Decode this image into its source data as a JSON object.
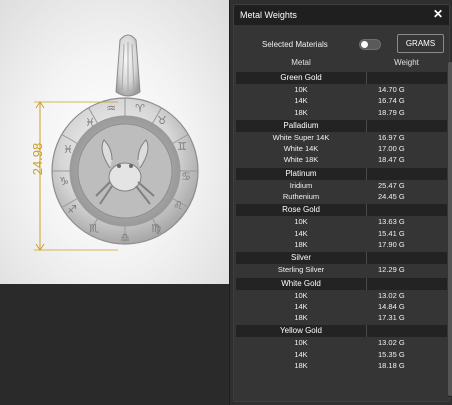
{
  "viewport": {
    "dimension_label": "24.98",
    "accent_color": "#c9a227"
  },
  "panel": {
    "title": "Metal Weights",
    "close_icon": "close-icon",
    "selected_materials_label": "Selected Materials",
    "selected_materials_toggle_on": false,
    "unit_button_label": "GRAMS",
    "columns": [
      "Metal",
      "Weight"
    ],
    "groups": [
      {
        "name": "Green Gold",
        "rows": [
          {
            "metal": "10K",
            "weight": "14.70 G"
          },
          {
            "metal": "14K",
            "weight": "16.74 G"
          },
          {
            "metal": "18K",
            "weight": "18.79 G"
          }
        ]
      },
      {
        "name": "Palladium",
        "rows": [
          {
            "metal": "White Super 14K",
            "weight": "16.97 G"
          },
          {
            "metal": "White 14K",
            "weight": "17.00 G"
          },
          {
            "metal": "White 18K",
            "weight": "18.47 G"
          }
        ]
      },
      {
        "name": "Platinum",
        "rows": [
          {
            "metal": "Iridium",
            "weight": "25.47 G"
          },
          {
            "metal": "Ruthenium",
            "weight": "24.45 G"
          }
        ]
      },
      {
        "name": "Rose Gold",
        "rows": [
          {
            "metal": "10K",
            "weight": "13.63 G"
          },
          {
            "metal": "14K",
            "weight": "15.41 G"
          },
          {
            "metal": "18K",
            "weight": "17.90 G"
          }
        ]
      },
      {
        "name": "Silver",
        "rows": [
          {
            "metal": "Sterling Silver",
            "weight": "12.29 G"
          }
        ]
      },
      {
        "name": "White Gold",
        "rows": [
          {
            "metal": "10K",
            "weight": "13.02 G"
          },
          {
            "metal": "14K",
            "weight": "14.84 G"
          },
          {
            "metal": "18K",
            "weight": "17.31 G"
          }
        ]
      },
      {
        "name": "Yellow Gold",
        "rows": [
          {
            "metal": "10K",
            "weight": "13.02 G"
          },
          {
            "metal": "14K",
            "weight": "15.35 G"
          },
          {
            "metal": "18K",
            "weight": "18.18 G"
          }
        ]
      }
    ]
  }
}
